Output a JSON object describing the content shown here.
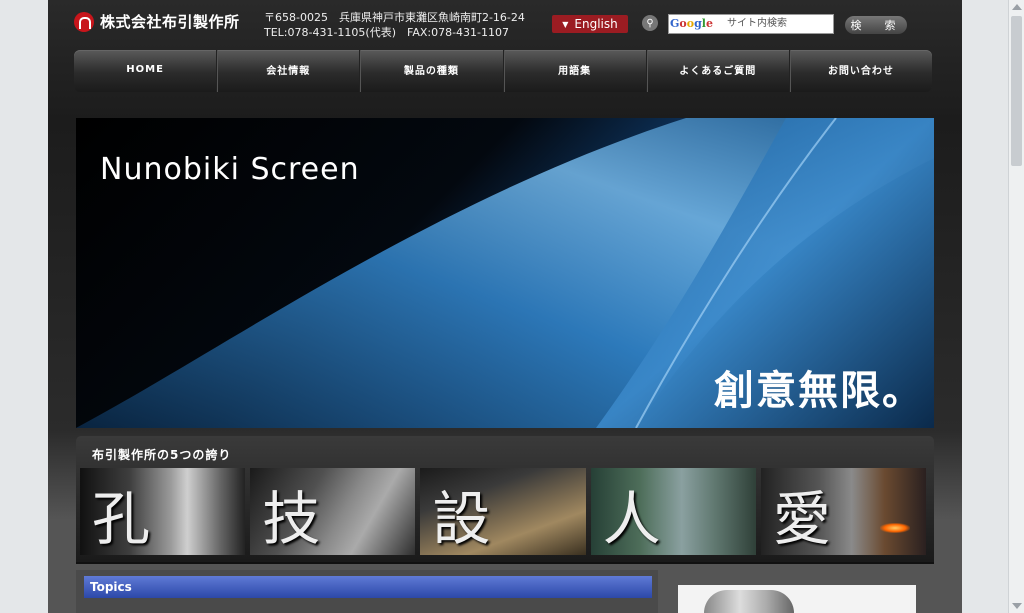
{
  "header": {
    "logo_text": "株式会社布引製作所",
    "address_line": "〒658-0025　兵庫県神戸市東灘区魚崎南町2-16-24",
    "contact_line": "TEL:078-431-1105(代表)　FAX:078-431-1107",
    "english_label": "English",
    "search_placeholder": "サイト内検索",
    "google_label": "Google",
    "search_button": "検　索"
  },
  "nav": {
    "items": [
      {
        "label": "HOME"
      },
      {
        "label": "会社情報"
      },
      {
        "label": "製品の種類"
      },
      {
        "label": "用語集"
      },
      {
        "label": "よくあるご質問"
      },
      {
        "label": "お問い合わせ"
      }
    ]
  },
  "hero": {
    "title": "Nunobiki Screen",
    "slogan": "創意無限。"
  },
  "pride": {
    "title": "布引製作所の5つの誇り",
    "tiles": [
      {
        "kanji": "孔"
      },
      {
        "kanji": "技"
      },
      {
        "kanji": "設"
      },
      {
        "kanji": "人"
      },
      {
        "kanji": "愛"
      }
    ]
  },
  "topics": {
    "title": "Topics"
  },
  "colors": {
    "logo_red": "#c8151b",
    "english_button": "#9b1c22",
    "topics_bar": "#3b57b8"
  }
}
